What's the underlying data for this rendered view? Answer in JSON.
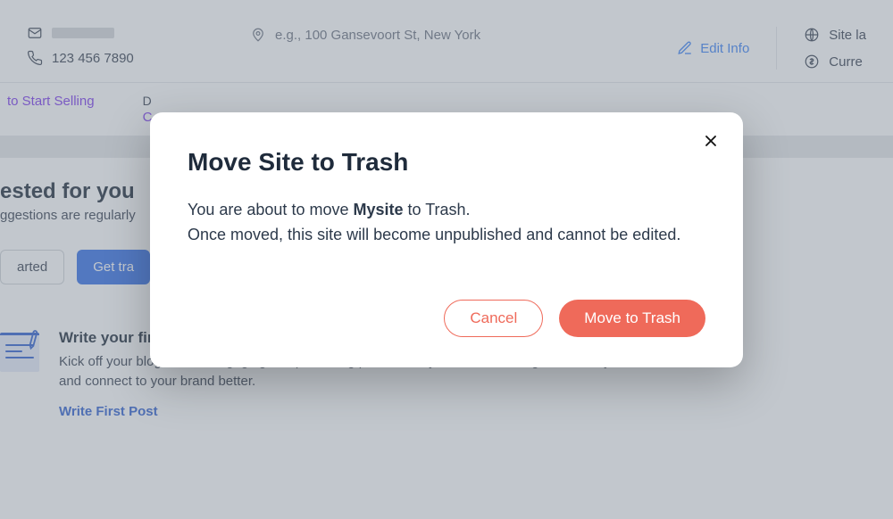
{
  "info": {
    "phone": "123 456 7890",
    "address_placeholder": "e.g., 100 Gansevoort St, New York",
    "edit_label": "Edit Info",
    "site_lang_label": "Site la",
    "currency_label": "Curre"
  },
  "sublinks": {
    "left_top": "",
    "left_bottom": "to Start Selling",
    "right_top": "D",
    "right_bottom": "C"
  },
  "suggest": {
    "title_fragment": "ested for you",
    "subtitle_fragment": "ggestions are regularly ",
    "btn_outline": "arted",
    "btn_primary": "Get tra"
  },
  "blog": {
    "title": "Write your first blog post",
    "body": "Kick off your blog with an engaging first post. Blog posts allow your audience to get to know you, and connect to your brand better.",
    "link": "Write First Post"
  },
  "modal": {
    "title": "Move Site to Trash",
    "body_prefix": "You are about to move ",
    "site_name": "Mysite",
    "body_mid": " to Trash.",
    "body_rest": "Once moved, this site will become unpublished and cannot be edited.",
    "cancel": "Cancel",
    "confirm": "Move to Trash"
  }
}
